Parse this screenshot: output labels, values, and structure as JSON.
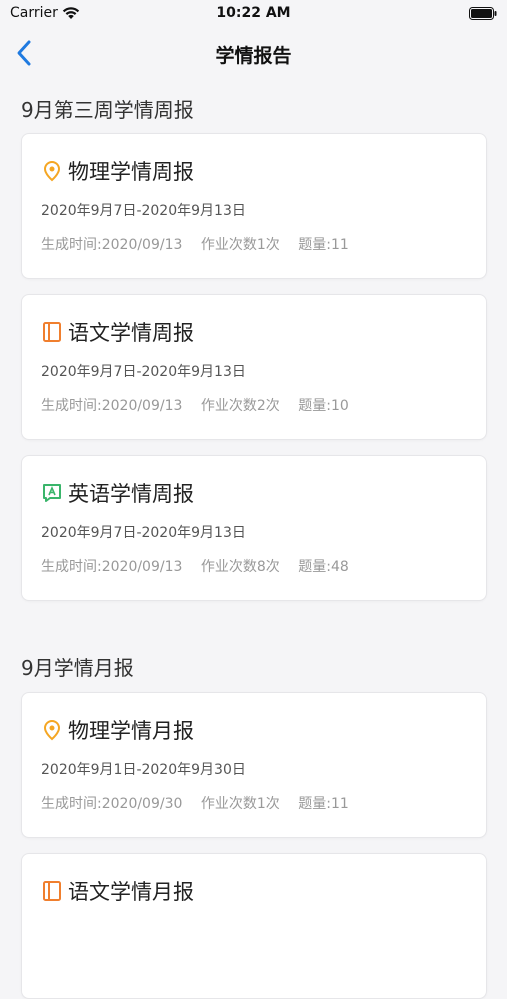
{
  "status": {
    "carrier": "Carrier",
    "time": "10:22 AM"
  },
  "nav": {
    "title": "学情报告"
  },
  "sections": [
    {
      "title": "9月第三周学情周报"
    },
    {
      "title": "9月学情月报"
    }
  ],
  "cards": [
    {
      "icon": "pin-icon",
      "title": "物理学情周报",
      "date": "2020年9月7日-2020年9月13日",
      "generated": "生成时间:2020/09/13",
      "homework": "作业次数1次",
      "questions": "题量:11"
    },
    {
      "icon": "book-icon",
      "title": "语文学情周报",
      "date": "2020年9月7日-2020年9月13日",
      "generated": "生成时间:2020/09/13",
      "homework": "作业次数2次",
      "questions": "题量:10"
    },
    {
      "icon": "english-icon",
      "title": "英语学情周报",
      "date": "2020年9月7日-2020年9月13日",
      "generated": "生成时间:2020/09/13",
      "homework": "作业次数8次",
      "questions": "题量:48"
    },
    {
      "icon": "pin-icon",
      "title": "物理学情月报",
      "date": "2020年9月1日-2020年9月30日",
      "generated": "生成时间:2020/09/30",
      "homework": "作业次数1次",
      "questions": "题量:11"
    },
    {
      "icon": "book-icon",
      "title": "语文学情月报",
      "date": "",
      "generated": "",
      "homework": "",
      "questions": ""
    }
  ],
  "colors": {
    "accent": "#1f7ae0",
    "pin": "#f5a623",
    "book": "#f07f2e",
    "english": "#3ab56b"
  }
}
